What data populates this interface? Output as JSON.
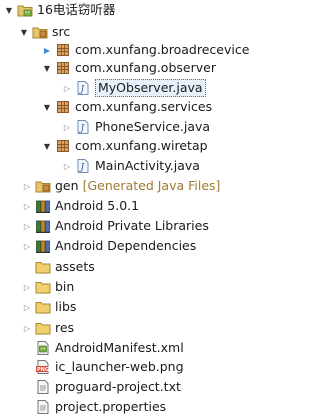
{
  "project": {
    "name": "16电话窃听器"
  },
  "src": {
    "label": "src",
    "packages": [
      {
        "label": "com.xunfang.broadrecevice"
      },
      {
        "label": "com.xunfang.observer",
        "file": "MyObserver.java"
      },
      {
        "label": "com.xunfang.services",
        "file": "PhoneService.java"
      },
      {
        "label": "com.xunfang.wiretap",
        "file": "MainActivity.java"
      }
    ]
  },
  "gen": {
    "label": "gen",
    "decoration": "[Generated Java Files]"
  },
  "libraries": [
    {
      "label": "Android 5.0.1"
    },
    {
      "label": "Android Private Libraries"
    },
    {
      "label": "Android Dependencies"
    }
  ],
  "folders": [
    {
      "label": "assets"
    },
    {
      "label": "bin"
    },
    {
      "label": "libs"
    },
    {
      "label": "res"
    }
  ],
  "files": [
    {
      "label": "AndroidManifest.xml"
    },
    {
      "label": "ic_launcher-web.png"
    },
    {
      "label": "proguard-project.txt"
    },
    {
      "label": "project.properties"
    }
  ]
}
